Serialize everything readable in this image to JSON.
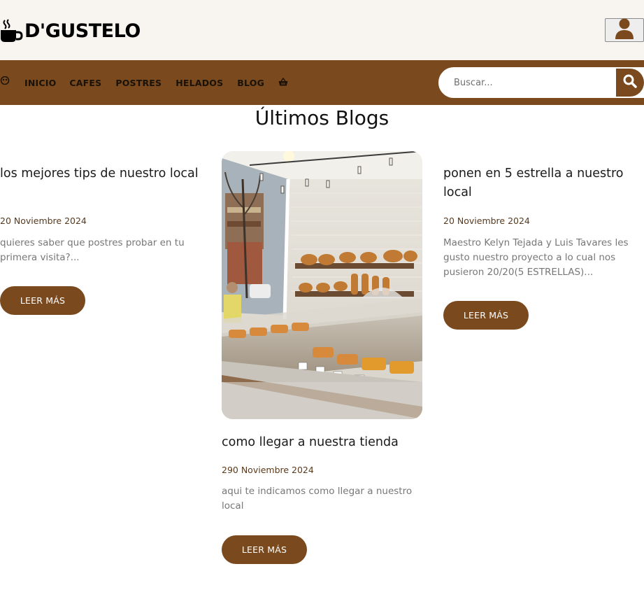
{
  "brand": {
    "name": "D'GUSTELO",
    "icon": "coffee-cup-icon"
  },
  "header": {
    "user_icon": "user-icon"
  },
  "nav": {
    "toggle_icon": "nav-toggle-icon",
    "items": [
      "INICIO",
      "CAFES",
      "POSTRES",
      "HELADOS",
      "BLOG"
    ],
    "cart_icon": "basket-icon"
  },
  "search": {
    "placeholder": "Buscar...",
    "button_icon": "search-icon"
  },
  "main": {
    "title": "Últimos Blogs",
    "posts": [
      {
        "title": "los mejores tips de nuestro local",
        "date": "20 Noviembre 2024",
        "excerpt": "quieres saber que postres probar en tu primera visita?...",
        "button": "LEER MÁS"
      },
      {
        "title": "como llegar a nuestra tienda",
        "date": "290 Noviembre 2024",
        "excerpt": "aqui te indicamos como llegar a nuestro local",
        "button": "LEER MÁS",
        "image": "bakery-display-photo"
      },
      {
        "title": "ponen en 5 estrella a nuestro local",
        "date": "20 Noviembre 2024",
        "excerpt": "Maestro Kelyn Tejada y Luis Tavares les gusto nuestro proyecto a lo cual nos pusieron 20/20(5 ESTRELLAS)...",
        "button": "LEER MÁS"
      }
    ]
  },
  "colors": {
    "brand_brown": "#7a4a1e",
    "header_bg": "#f8f4ef",
    "date_color": "#5a3a1c",
    "excerpt_color": "#777777"
  }
}
